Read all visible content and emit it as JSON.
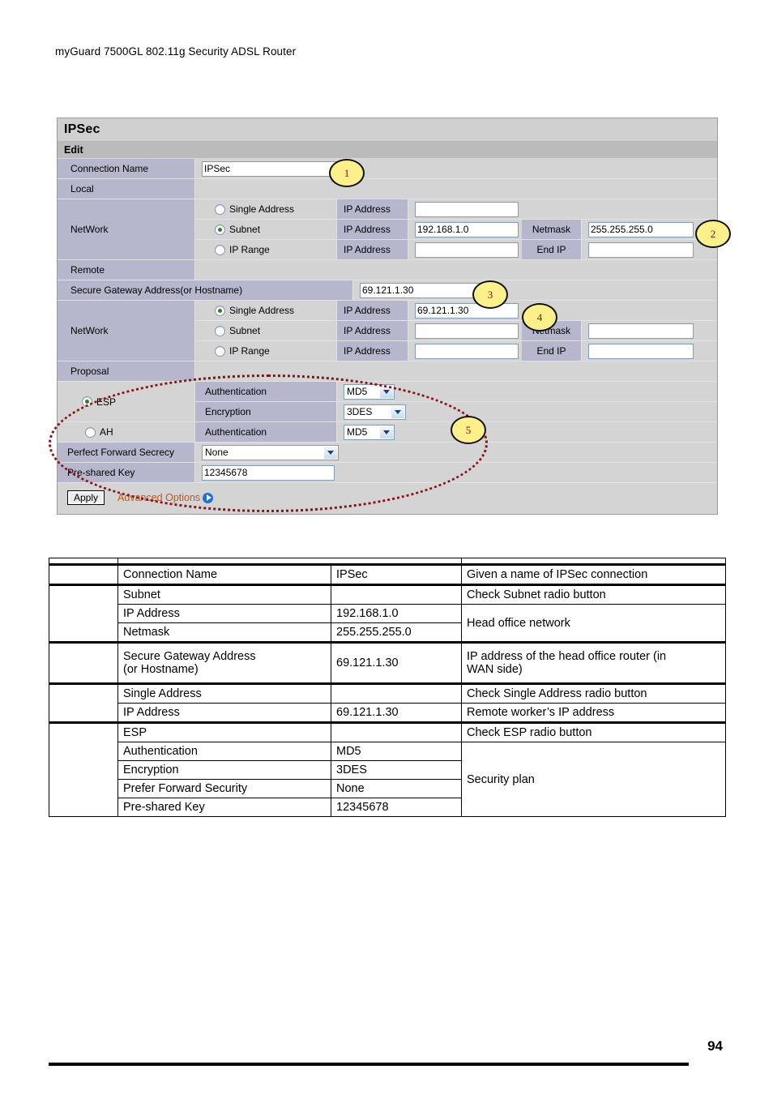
{
  "document": {
    "header": "myGuard 7500GL 802.11g Security ADSL Router",
    "page_number": "94"
  },
  "panel": {
    "title": "IPSec",
    "subtitle": "Edit",
    "rows": {
      "connection_name_label": "Connection Name",
      "connection_name_value": "IPSec",
      "local_label": "Local",
      "remote_label": "Remote",
      "network_label": "NetWork",
      "secure_gateway_label": "Secure Gateway Address(or Hostname)",
      "secure_gateway_value": "69.121.1.30",
      "proposal_label": "Proposal",
      "pfs_label": "Perfect Forward Secrecy",
      "pfs_value": "None",
      "psk_label": "Pre-shared Key",
      "psk_value": "12345678"
    },
    "local_network": [
      {
        "radio": "Single Address",
        "selected": false,
        "ip_label": "IP Address",
        "ip_value": "",
        "second_label": "",
        "second_value": ""
      },
      {
        "radio": "Subnet",
        "selected": true,
        "ip_label": "IP Address",
        "ip_value": "192.168.1.0",
        "second_label": "Netmask",
        "second_value": "255.255.255.0"
      },
      {
        "radio": "IP Range",
        "selected": false,
        "ip_label": "IP Address",
        "ip_value": "",
        "second_label": "End IP",
        "second_value": ""
      }
    ],
    "remote_network": [
      {
        "radio": "Single Address",
        "selected": true,
        "ip_label": "IP Address",
        "ip_value": "69.121.1.30",
        "second_label": "",
        "second_value": ""
      },
      {
        "radio": "Subnet",
        "selected": false,
        "ip_label": "IP Address",
        "ip_value": "",
        "second_label": "Netmask",
        "second_value": ""
      },
      {
        "radio": "IP Range",
        "selected": false,
        "ip_label": "IP Address",
        "ip_value": "",
        "second_label": "End IP",
        "second_value": ""
      }
    ],
    "proposal": {
      "esp_label": "ESP",
      "esp_selected": true,
      "ah_label": "AH",
      "ah_selected": false,
      "esp_auth_label": "Authentication",
      "esp_auth_value": "MD5",
      "esp_enc_label": "Encryption",
      "esp_enc_value": "3DES",
      "ah_auth_label": "Authentication",
      "ah_auth_value": "MD5"
    },
    "actions": {
      "apply_label": "Apply",
      "advanced_label": "Advanced Options"
    },
    "callouts": [
      "1",
      "2",
      "3",
      "4",
      "5"
    ]
  },
  "table": {
    "rows": [
      {
        "field": "",
        "value": "",
        "desc": ""
      },
      {
        "field": "Connection Name",
        "value": "IPSec",
        "desc": "Given a name of IPSec connection"
      },
      {
        "field": "Subnet",
        "value": "",
        "desc": "Check Subnet radio button"
      },
      {
        "field": "IP Address",
        "value": "192.168.1.0",
        "desc": "Head office network"
      },
      {
        "field": "Netmask",
        "value": "255.255.255.0",
        "desc": ""
      },
      {
        "field": "Secure Gateway Address (or Hostname)",
        "value": "69.121.1.30",
        "desc": "IP address of the head office router (in WAN side)"
      },
      {
        "field": "Single Address",
        "value": "",
        "desc": "Check Single Address radio button"
      },
      {
        "field": "IP Address",
        "value": "69.121.1.30",
        "desc": "Remote worker’s IP address"
      },
      {
        "field": "ESP",
        "value": "",
        "desc": "Check ESP radio button"
      },
      {
        "field": "Authentication",
        "value": "MD5",
        "desc": "Security plan"
      },
      {
        "field": "Encryption",
        "value": "3DES",
        "desc": ""
      },
      {
        "field": "Prefer Forward Security",
        "value": "None",
        "desc": ""
      },
      {
        "field": "Pre-shared Key",
        "value": "12345678",
        "desc": ""
      }
    ],
    "secure_gateway_line1": "Secure Gateway Address",
    "secure_gateway_line2": "(or Hostname)",
    "wan_line1": "IP address of the head office router (in",
    "wan_line2": "WAN side)"
  }
}
